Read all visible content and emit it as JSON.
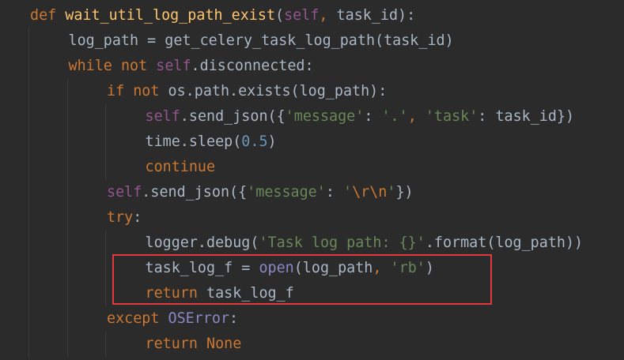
{
  "editor": {
    "language": "python",
    "lines": [
      [
        {
          "t": "def",
          "c": "kw"
        },
        {
          "t": " ",
          "c": "plain"
        },
        {
          "t": "wait_util_log_path_exist",
          "c": "fn"
        },
        {
          "t": "(",
          "c": "plain"
        },
        {
          "t": "self",
          "c": "selfkw"
        },
        {
          "t": ",",
          "c": "kw"
        },
        {
          "t": " task_id):",
          "c": "plain"
        }
      ],
      [
        {
          "t": "log_path = get_celery_task_log_path(task_id)",
          "c": "plain"
        }
      ],
      [
        {
          "t": "while",
          "c": "kw"
        },
        {
          "t": " ",
          "c": "plain"
        },
        {
          "t": "not",
          "c": "kw"
        },
        {
          "t": " ",
          "c": "plain"
        },
        {
          "t": "self",
          "c": "selfkw"
        },
        {
          "t": ".disconnected:",
          "c": "plain"
        }
      ],
      [
        {
          "t": "if",
          "c": "kw"
        },
        {
          "t": " ",
          "c": "plain"
        },
        {
          "t": "not",
          "c": "kw"
        },
        {
          "t": " os.path.exists(log_path):",
          "c": "plain"
        }
      ],
      [
        {
          "t": "self",
          "c": "selfkw"
        },
        {
          "t": ".send_json({",
          "c": "plain"
        },
        {
          "t": "'message'",
          "c": "str"
        },
        {
          "t": ": ",
          "c": "plain"
        },
        {
          "t": "'.'",
          "c": "str"
        },
        {
          "t": ", ",
          "c": "kw"
        },
        {
          "t": "'task'",
          "c": "str"
        },
        {
          "t": ": task_id})",
          "c": "plain"
        }
      ],
      [
        {
          "t": "time.sleep(",
          "c": "plain"
        },
        {
          "t": "0.5",
          "c": "num"
        },
        {
          "t": ")",
          "c": "plain"
        }
      ],
      [
        {
          "t": "continue",
          "c": "kw"
        }
      ],
      [
        {
          "t": "self",
          "c": "selfkw"
        },
        {
          "t": ".send_json({",
          "c": "plain"
        },
        {
          "t": "'message'",
          "c": "str"
        },
        {
          "t": ": ",
          "c": "plain"
        },
        {
          "t": "'",
          "c": "str"
        },
        {
          "t": "\\r\\n",
          "c": "esc"
        },
        {
          "t": "'",
          "c": "str"
        },
        {
          "t": "})",
          "c": "plain"
        }
      ],
      [
        {
          "t": "try",
          "c": "kw"
        },
        {
          "t": ":",
          "c": "plain"
        }
      ],
      [
        {
          "t": "logger.debug(",
          "c": "plain"
        },
        {
          "t": "'Task log path: {}'",
          "c": "str"
        },
        {
          "t": ".format(log_path))",
          "c": "plain"
        }
      ],
      [
        {
          "t": "task_log_f = ",
          "c": "plain"
        },
        {
          "t": "open",
          "c": "builtin"
        },
        {
          "t": "(log_path",
          "c": "plain"
        },
        {
          "t": ", ",
          "c": "kw"
        },
        {
          "t": "'rb'",
          "c": "str"
        },
        {
          "t": ")",
          "c": "plain"
        }
      ],
      [
        {
          "t": "return",
          "c": "kw"
        },
        {
          "t": " task_log_f",
          "c": "plain"
        }
      ],
      [
        {
          "t": "except",
          "c": "kw"
        },
        {
          "t": " ",
          "c": "plain"
        },
        {
          "t": "OSError",
          "c": "builtin"
        },
        {
          "t": ":",
          "c": "plain"
        }
      ],
      [
        {
          "t": "return",
          "c": "kw"
        },
        {
          "t": " ",
          "c": "plain"
        },
        {
          "t": "None",
          "c": "kw"
        }
      ]
    ],
    "indent_levels": [
      0,
      1,
      1,
      2,
      3,
      3,
      3,
      2,
      2,
      3,
      3,
      3,
      2,
      3
    ],
    "highlight": {
      "from_line": 11,
      "to_line": 12,
      "color": "#e0393e"
    }
  }
}
